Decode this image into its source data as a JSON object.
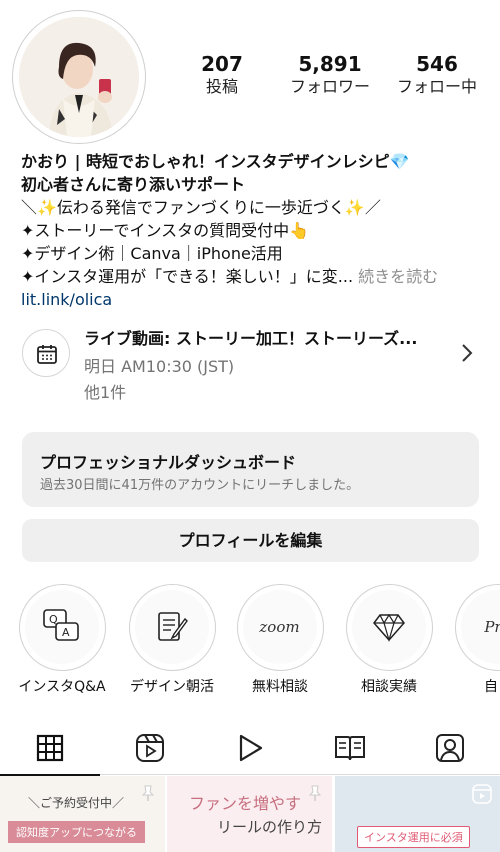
{
  "profile": {
    "stats": [
      {
        "value": "207",
        "label": "投稿"
      },
      {
        "value": "5,891",
        "label": "フォロワー"
      },
      {
        "value": "546",
        "label": "フォロー中"
      }
    ],
    "bio": {
      "name_line": "かおり | 時短でおしゃれ！インスタデザインレシピ💎",
      "line2": "初心者さんに寄り添いサポート",
      "line3": "＼✨伝わる発信でファンづくりに一歩近づく✨／",
      "line4": "✦ストーリーでインスタの質問受付中👆",
      "line5": "✦デザイン術｜Canva｜iPhone活用",
      "line6": "✦インスタ運用が「できる！楽しい！」に変...",
      "more": "続きを読む",
      "link": "lit.link/olica"
    }
  },
  "event": {
    "title": "ライブ動画: ストーリー加工！ストーリーズ...",
    "time": "明日 AM10:30 (JST)",
    "other": "他1件"
  },
  "dashboard": {
    "title": "プロフェッショナルダッシュボード",
    "subtitle": "過去30日間に41万件のアカウントにリーチしました。"
  },
  "edit_profile": "プロフィールを編集",
  "highlights": [
    {
      "label": "インスタQ&A"
    },
    {
      "label": "デザイン朝活"
    },
    {
      "label": "無料相談",
      "cover_text": "zoom"
    },
    {
      "label": "相談実績"
    },
    {
      "label": "自己",
      "cover_text": "Pro"
    }
  ],
  "tabs": [
    "grid",
    "reels",
    "video",
    "guides",
    "tagged"
  ],
  "posts": [
    {
      "top": "＼ご予約受付中／",
      "badge": "認知度アップにつながる"
    },
    {
      "top": "ファンを増やす",
      "bottom": "リールの作り方"
    },
    {
      "badge": "インスタ運用に必須"
    }
  ]
}
